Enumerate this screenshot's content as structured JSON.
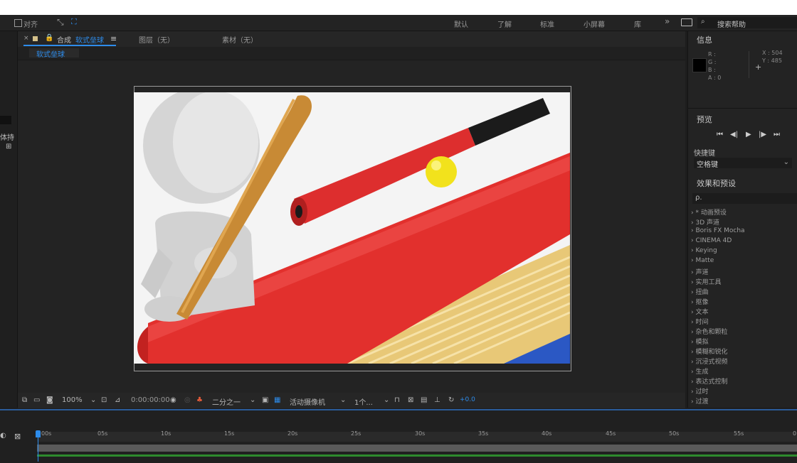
{
  "toolbar": {
    "align_label": "对齐",
    "workspaces": [
      "默认",
      "了解",
      "标准",
      "小屏幕",
      "库"
    ],
    "more_glyph": "»",
    "search_placeholder": "搜索帮助"
  },
  "composition": {
    "tab_prefix": "合成",
    "name": "软式垒球",
    "menu_glyph": "≡",
    "layer_tab": "图层（无）",
    "footage_tab": "素材（无）",
    "sub_tab": "软式垒球"
  },
  "left_strip": {
    "label": "体持"
  },
  "viewer_footer": {
    "zoom": "100%",
    "timecode": "0:00:00:00",
    "resolution": "二分之一",
    "camera": "活动摄像机",
    "views": "1个...",
    "exposure": "+0.0"
  },
  "info_panel": {
    "title": "信息",
    "channels": [
      "R :",
      "G :",
      "B :",
      "A : 0"
    ],
    "x_readout": "X : 504",
    "y_readout": "Y : 485"
  },
  "preview_panel": {
    "title": "预览",
    "shortcut_label": "快捷键",
    "shortcut_value": "空格键"
  },
  "effects_panel": {
    "title": "效果和预设",
    "search_glyph": "ρ.",
    "items": [
      "* 动画预设",
      "3D 声道",
      "Boris FX Mocha",
      "CINEMA 4D",
      "Keying",
      "Matte",
      "声道",
      "实用工具",
      "扭曲",
      "抠像",
      "文本",
      "时间",
      "杂色和颗粒",
      "模拟",
      "模糊和锐化",
      "沉浸式视频",
      "生成",
      "表达式控制",
      "过时",
      "过渡"
    ]
  },
  "timeline": {
    "ticks": [
      "00s",
      "05s",
      "10s",
      "15s",
      "20s",
      "25s",
      "30s",
      "35s",
      "40s",
      "45s",
      "50s",
      "55s",
      "0"
    ]
  },
  "colors": {
    "accent": "#2d8ceb",
    "track_green": "#2d8a2d"
  }
}
